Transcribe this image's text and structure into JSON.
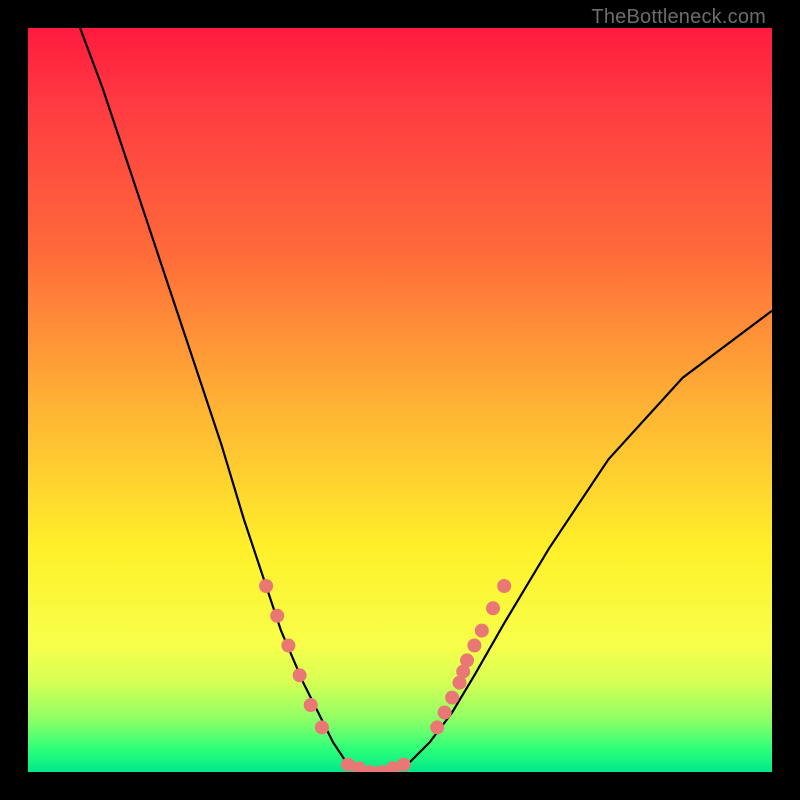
{
  "watermark": "TheBottleneck.com",
  "chart_data": {
    "type": "line",
    "title": "",
    "xlabel": "",
    "ylabel": "",
    "xlim": [
      0,
      100
    ],
    "ylim": [
      0,
      100
    ],
    "series": [
      {
        "name": "bottleneck-curve",
        "x": [
          7,
          10,
          14,
          18,
          22,
          26,
          29,
          32,
          34,
          37,
          39,
          41,
          43,
          45,
          48,
          51,
          54,
          57,
          60,
          64,
          70,
          78,
          88,
          100
        ],
        "values": [
          100,
          92,
          80,
          68,
          56,
          44,
          34,
          25,
          19,
          12,
          8,
          4,
          1,
          0,
          0,
          1,
          4,
          8,
          13,
          20,
          30,
          42,
          53,
          62
        ]
      }
    ],
    "markers": {
      "left_cluster": [
        {
          "x": 32,
          "y": 25
        },
        {
          "x": 33.5,
          "y": 21
        },
        {
          "x": 35,
          "y": 17
        },
        {
          "x": 36.5,
          "y": 13
        },
        {
          "x": 38,
          "y": 9
        },
        {
          "x": 39.5,
          "y": 6
        }
      ],
      "bottom_cluster": [
        {
          "x": 43,
          "y": 1
        },
        {
          "x": 44.5,
          "y": 0.5
        },
        {
          "x": 46,
          "y": 0
        },
        {
          "x": 47.5,
          "y": 0
        },
        {
          "x": 49,
          "y": 0.5
        },
        {
          "x": 50.5,
          "y": 1
        }
      ],
      "right_cluster": [
        {
          "x": 55,
          "y": 6
        },
        {
          "x": 56,
          "y": 8
        },
        {
          "x": 57,
          "y": 10
        },
        {
          "x": 58,
          "y": 12
        },
        {
          "x": 58.5,
          "y": 13.5
        },
        {
          "x": 59,
          "y": 15
        },
        {
          "x": 60,
          "y": 17
        },
        {
          "x": 61,
          "y": 19
        },
        {
          "x": 62.5,
          "y": 22
        },
        {
          "x": 64,
          "y": 25
        }
      ]
    },
    "colors": {
      "curve": "#000000",
      "markers": "#e97874",
      "gradient_top": "#ff1a3e",
      "gradient_mid1": "#ff6a3a",
      "gradient_mid2": "#fff02a",
      "gradient_bottom": "#00e88a"
    }
  }
}
